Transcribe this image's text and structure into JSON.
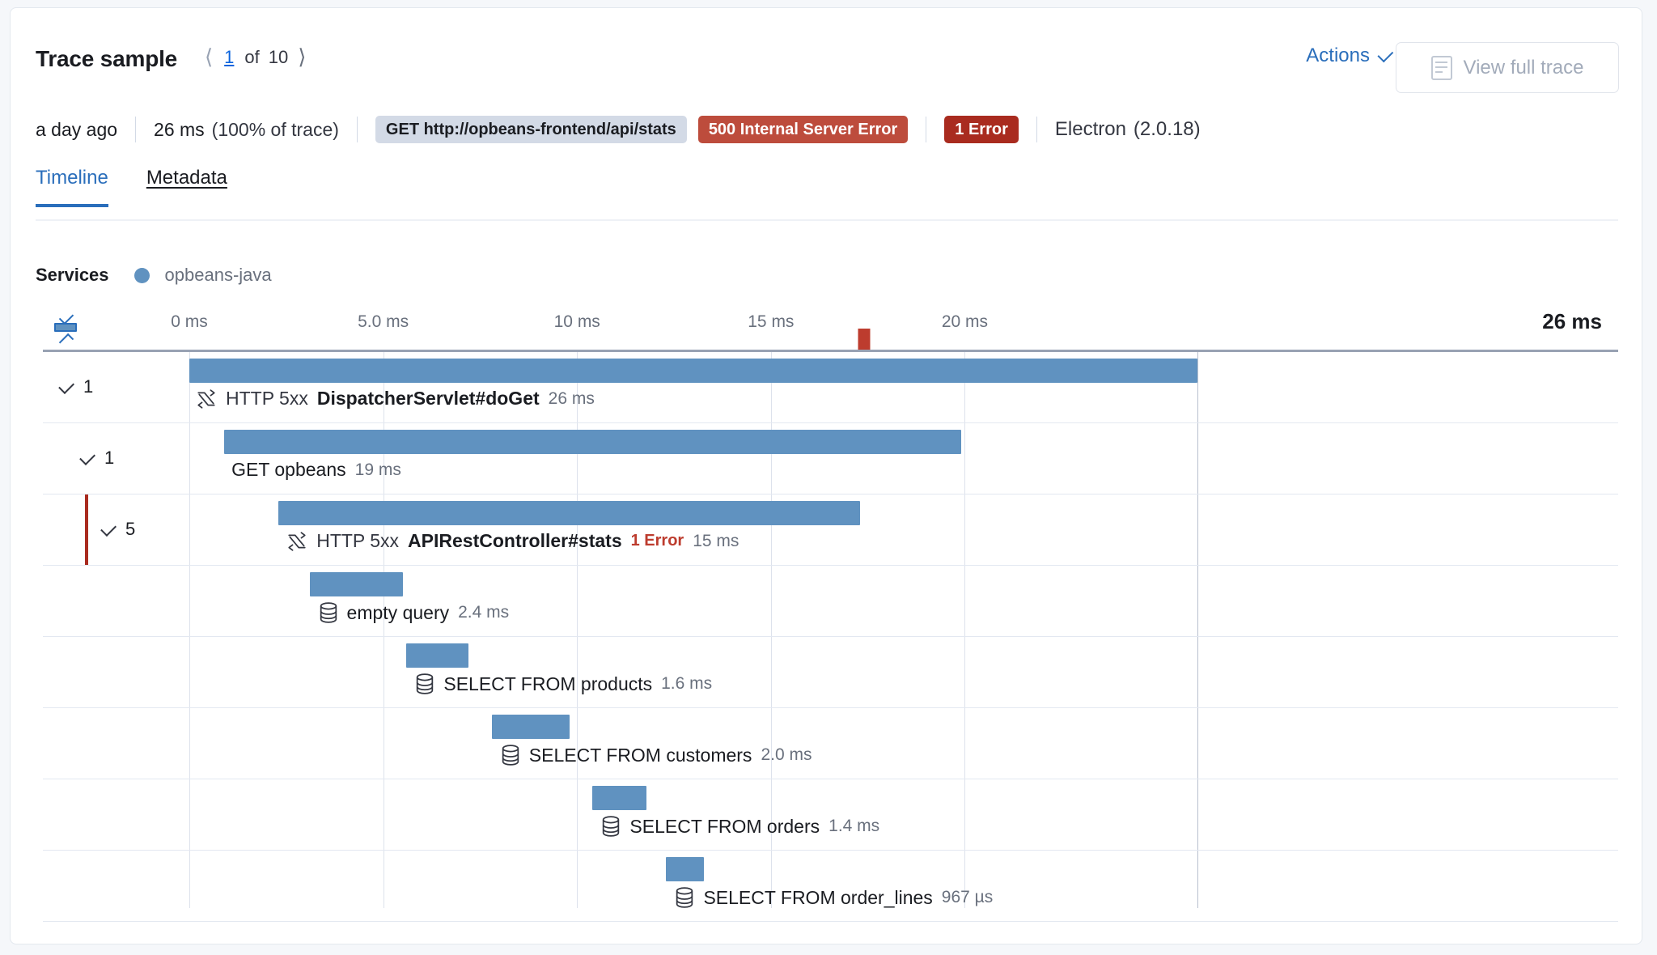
{
  "header": {
    "title": "Trace sample",
    "pager": {
      "prev_icon": "chevron-left-icon",
      "current": "1",
      "of": "of",
      "total": "10",
      "next_icon": "chevron-right-icon"
    },
    "actions_label": "Actions",
    "actions_icon": "chevron-down-icon",
    "view_full_trace_label": "View full trace",
    "view_full_trace_icon": "document-icon"
  },
  "meta": {
    "timestamp": "a day ago",
    "duration": "26 ms",
    "percent_of_trace": "(100% of trace)",
    "url_badge": "GET http://opbeans-frontend/api/stats",
    "http_badge": "500 Internal Server Error",
    "error_badge": "1 Error",
    "agent": "Electron",
    "agent_version": "(2.0.18)"
  },
  "tabs": [
    {
      "label": "Timeline",
      "active": true
    },
    {
      "label": "Metadata",
      "active": false
    }
  ],
  "services": {
    "label": "Services",
    "items": [
      {
        "name": "opbeans-java",
        "color": "#6092c0"
      }
    ]
  },
  "timeline": {
    "collapse_icon": "collapse-all-icon",
    "axis": {
      "ticks": [
        "0 ms",
        "5.0 ms",
        "10 ms",
        "15 ms",
        "20 ms"
      ],
      "tick_values": [
        0,
        5,
        10,
        15,
        20
      ],
      "max_label": "26 ms",
      "max_value": 26,
      "error_marker_value": 17.4
    },
    "rows": [
      {
        "toggle_count": "1",
        "indent": 0,
        "has_toggle": true,
        "icon": "http-transaction-icon",
        "type_label": "HTTP 5xx",
        "name": "DispatcherServlet#doGet",
        "bold": true,
        "duration": "26 ms",
        "start": 0,
        "width": 26,
        "label_offset": 8,
        "error_accent": false,
        "error_link": null
      },
      {
        "toggle_count": "1",
        "indent": 26,
        "has_toggle": true,
        "icon": null,
        "type_label": null,
        "name": "GET opbeans",
        "bold": false,
        "duration": "19 ms",
        "start": 0.9,
        "width": 19,
        "label_offset": 9,
        "error_accent": false,
        "error_link": null
      },
      {
        "toggle_count": "5",
        "indent": 52,
        "has_toggle": true,
        "icon": "http-transaction-icon",
        "type_label": "HTTP 5xx",
        "name": "APIRestController#stats",
        "bold": true,
        "duration": "15 ms",
        "start": 2.3,
        "width": 15,
        "label_offset": 10,
        "error_accent": true,
        "error_link": "1 Error"
      },
      {
        "toggle_count": null,
        "indent": 52,
        "has_toggle": false,
        "icon": "database-icon",
        "type_label": null,
        "name": "empty query",
        "bold": false,
        "duration": "2.4 ms",
        "start": 3.1,
        "width": 2.4,
        "label_offset": 11,
        "error_accent": false,
        "error_link": null
      },
      {
        "toggle_count": null,
        "indent": 52,
        "has_toggle": false,
        "icon": "database-icon",
        "type_label": null,
        "name": "SELECT FROM products",
        "bold": false,
        "duration": "1.6 ms",
        "start": 5.6,
        "width": 1.6,
        "label_offset": 11,
        "error_accent": false,
        "error_link": null
      },
      {
        "toggle_count": null,
        "indent": 52,
        "has_toggle": false,
        "icon": "database-icon",
        "type_label": null,
        "name": "SELECT FROM customers",
        "bold": false,
        "duration": "2.0 ms",
        "start": 7.8,
        "width": 2.0,
        "label_offset": 11,
        "error_accent": false,
        "error_link": null
      },
      {
        "toggle_count": null,
        "indent": 52,
        "has_toggle": false,
        "icon": "database-icon",
        "type_label": null,
        "name": "SELECT FROM orders",
        "bold": false,
        "duration": "1.4 ms",
        "start": 10.4,
        "width": 1.4,
        "label_offset": 11,
        "error_accent": false,
        "error_link": null
      },
      {
        "toggle_count": null,
        "indent": 52,
        "has_toggle": false,
        "icon": "database-icon",
        "type_label": null,
        "name": "SELECT FROM order_lines",
        "bold": false,
        "duration": "967 µs",
        "start": 12.3,
        "width": 0.967,
        "label_offset": 11,
        "error_accent": false,
        "error_link": null
      }
    ]
  },
  "colors": {
    "bar": "#6092c0",
    "error": "#bd3c2e",
    "error_dark": "#a92b1f",
    "accent_link": "#2a6ebb",
    "badge_neutral": "#d3dae6"
  }
}
